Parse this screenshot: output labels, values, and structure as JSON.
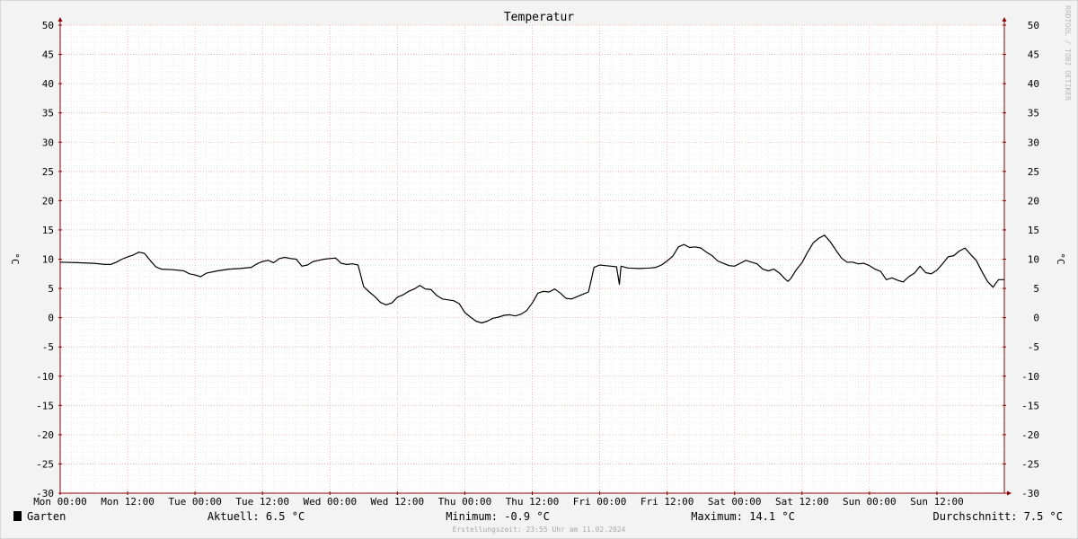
{
  "chart_data": {
    "type": "line",
    "title": "Temperatur",
    "ylabel_left": "°C",
    "ylabel_right": "°C",
    "ylim": [
      -30,
      50
    ],
    "y_ticks": [
      50,
      45,
      40,
      35,
      30,
      25,
      20,
      15,
      10,
      5,
      0,
      -5,
      -10,
      -15,
      -20,
      -25,
      -30
    ],
    "x_tick_labels": [
      "Mon 00:00",
      "Mon 12:00",
      "Tue 00:00",
      "Tue 12:00",
      "Wed 00:00",
      "Wed 12:00",
      "Thu 00:00",
      "Thu 12:00",
      "Fri 00:00",
      "Fri 12:00",
      "Sat 00:00",
      "Sat 12:00",
      "Sun 00:00",
      "Sun 12:00"
    ],
    "x_unit": "hours since Mon 00:00",
    "xlim": [
      0,
      168
    ],
    "grid": true,
    "legend_position": "bottom",
    "series": [
      {
        "name": "Garten",
        "color": "#000000",
        "points": [
          [
            0,
            9.5
          ],
          [
            3,
            9.4
          ],
          [
            6,
            9.3
          ],
          [
            8,
            9.1
          ],
          [
            9,
            9.1
          ],
          [
            10,
            9.5
          ],
          [
            11,
            10.0
          ],
          [
            12,
            10.4
          ],
          [
            13,
            10.7
          ],
          [
            14,
            11.2
          ],
          [
            15,
            11.0
          ],
          [
            16,
            9.8
          ],
          [
            17,
            8.7
          ],
          [
            18,
            8.3
          ],
          [
            20,
            8.2
          ],
          [
            22,
            8.0
          ],
          [
            23,
            7.5
          ],
          [
            24,
            7.3
          ],
          [
            25,
            7.0
          ],
          [
            26,
            7.6
          ],
          [
            28,
            8.0
          ],
          [
            30,
            8.3
          ],
          [
            32,
            8.4
          ],
          [
            34,
            8.6
          ],
          [
            35,
            9.2
          ],
          [
            36,
            9.6
          ],
          [
            37,
            9.8
          ],
          [
            38,
            9.4
          ],
          [
            39,
            10.1
          ],
          [
            40,
            10.3
          ],
          [
            41,
            10.1
          ],
          [
            42,
            10.0
          ],
          [
            43,
            8.8
          ],
          [
            44,
            9.0
          ],
          [
            45,
            9.6
          ],
          [
            46,
            9.8
          ],
          [
            47,
            10.0
          ],
          [
            48,
            10.1
          ],
          [
            49,
            10.2
          ],
          [
            50,
            9.3
          ],
          [
            51,
            9.1
          ],
          [
            52,
            9.2
          ],
          [
            53,
            9.0
          ],
          [
            54,
            5.3
          ],
          [
            55,
            4.4
          ],
          [
            56,
            3.6
          ],
          [
            57,
            2.6
          ],
          [
            58,
            2.2
          ],
          [
            59,
            2.5
          ],
          [
            60,
            3.5
          ],
          [
            61,
            3.9
          ],
          [
            62,
            4.5
          ],
          [
            63,
            4.9
          ],
          [
            64,
            5.5
          ],
          [
            65,
            4.9
          ],
          [
            66,
            4.8
          ],
          [
            67,
            3.8
          ],
          [
            68,
            3.2
          ],
          [
            70,
            2.9
          ],
          [
            71,
            2.4
          ],
          [
            72,
            0.9
          ],
          [
            73,
            0.1
          ],
          [
            74,
            -0.6
          ],
          [
            75,
            -0.9
          ],
          [
            76,
            -0.6
          ],
          [
            77,
            -0.1
          ],
          [
            78,
            0.1
          ],
          [
            79,
            0.4
          ],
          [
            80,
            0.5
          ],
          [
            81,
            0.3
          ],
          [
            82,
            0.6
          ],
          [
            83,
            1.2
          ],
          [
            84,
            2.5
          ],
          [
            85,
            4.2
          ],
          [
            86,
            4.5
          ],
          [
            87,
            4.4
          ],
          [
            88,
            4.9
          ],
          [
            89,
            4.2
          ],
          [
            90,
            3.3
          ],
          [
            91,
            3.2
          ],
          [
            92,
            3.6
          ],
          [
            93,
            4.0
          ],
          [
            94,
            4.4
          ],
          [
            95,
            8.6
          ],
          [
            96,
            9.0
          ],
          [
            97,
            8.9
          ],
          [
            98,
            8.8
          ],
          [
            99,
            8.7
          ],
          [
            99.5,
            5.7
          ],
          [
            99.8,
            8.8
          ],
          [
            101,
            8.5
          ],
          [
            103,
            8.4
          ],
          [
            105,
            8.5
          ],
          [
            106,
            8.6
          ],
          [
            107,
            9.0
          ],
          [
            108,
            9.7
          ],
          [
            109,
            10.5
          ],
          [
            110,
            12.1
          ],
          [
            111,
            12.5
          ],
          [
            112,
            12.0
          ],
          [
            113,
            12.1
          ],
          [
            114,
            11.9
          ],
          [
            115,
            11.2
          ],
          [
            116,
            10.6
          ],
          [
            117,
            9.7
          ],
          [
            118,
            9.3
          ],
          [
            119,
            8.9
          ],
          [
            120,
            8.8
          ],
          [
            121,
            9.3
          ],
          [
            122,
            9.8
          ],
          [
            123,
            9.5
          ],
          [
            124,
            9.2
          ],
          [
            125,
            8.3
          ],
          [
            126,
            8.0
          ],
          [
            127,
            8.3
          ],
          [
            128,
            7.6
          ],
          [
            129,
            6.6
          ],
          [
            129.5,
            6.2
          ],
          [
            130,
            6.7
          ],
          [
            131,
            8.2
          ],
          [
            132,
            9.4
          ],
          [
            133,
            11.2
          ],
          [
            134,
            12.8
          ],
          [
            135,
            13.6
          ],
          [
            136,
            14.1
          ],
          [
            137,
            13.0
          ],
          [
            138,
            11.6
          ],
          [
            139,
            10.2
          ],
          [
            140,
            9.5
          ],
          [
            141,
            9.5
          ],
          [
            142,
            9.2
          ],
          [
            143,
            9.3
          ],
          [
            144,
            8.9
          ],
          [
            145,
            8.3
          ],
          [
            146,
            7.9
          ],
          [
            147,
            6.5
          ],
          [
            148,
            6.8
          ],
          [
            149,
            6.4
          ],
          [
            150,
            6.1
          ],
          [
            151,
            7.0
          ],
          [
            152,
            7.6
          ],
          [
            153,
            8.8
          ],
          [
            154,
            7.7
          ],
          [
            155,
            7.5
          ],
          [
            156,
            8.1
          ],
          [
            157,
            9.2
          ],
          [
            158,
            10.4
          ],
          [
            159,
            10.6
          ],
          [
            160,
            11.4
          ],
          [
            161,
            11.9
          ],
          [
            162,
            10.8
          ],
          [
            163,
            9.8
          ],
          [
            164,
            7.9
          ],
          [
            165,
            6.2
          ],
          [
            166,
            5.2
          ],
          [
            166.5,
            5.9
          ],
          [
            167,
            6.5
          ],
          [
            168,
            6.5
          ]
        ]
      }
    ]
  },
  "legend": {
    "series_name": "Garten",
    "swatch_color": "#000000",
    "current": "Aktuell: 6.5 °C",
    "minimum": "Minimum: -0.9 °C",
    "maximum": "Maximum: 14.1 °C",
    "average": "Durchschnitt: 7.5 °C"
  },
  "footer": "Erstellungszeit: 23:55 Uhr am 11.02.2024",
  "watermark": "RRDTOOL / TOBI OETIKER",
  "colors": {
    "background": "#f3f3f3",
    "plot_background": "#ffffff",
    "minor_grid": "#dedede",
    "major_grid": "#f0a8a8",
    "axis": "#8b0000",
    "line": "#000000"
  }
}
